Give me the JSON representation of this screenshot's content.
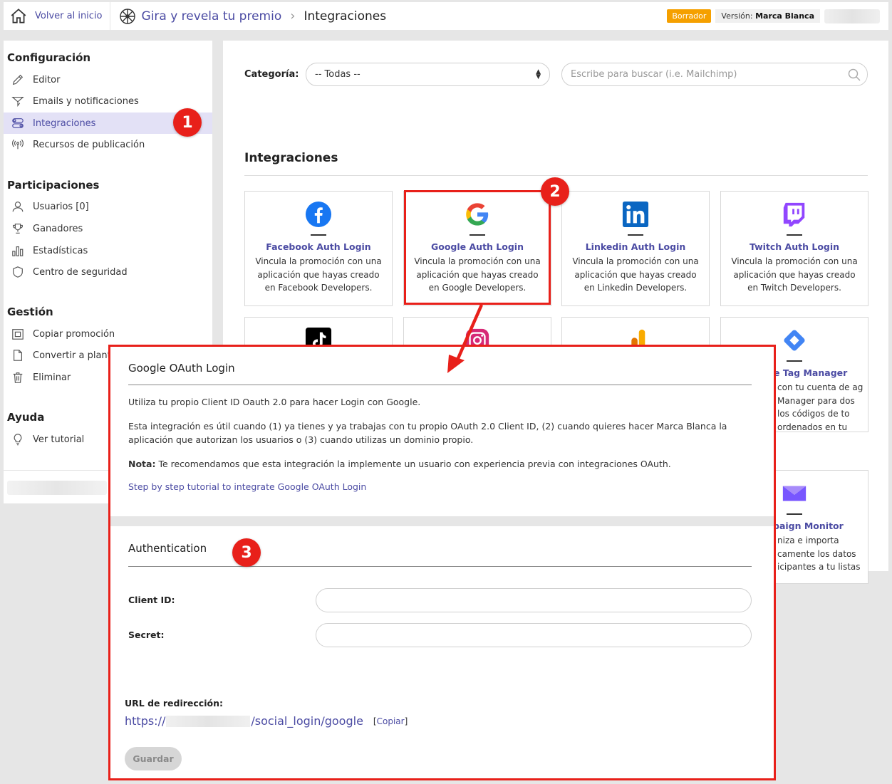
{
  "topbar": {
    "home_label": "Volver al inicio",
    "campaign_title": "Gira y revela tu premio",
    "current_page": "Integraciones",
    "status_badge": "Borrador",
    "version_prefix": "Versión:",
    "version_value": "Marca Blanca"
  },
  "sidebar": {
    "sections": [
      {
        "title": "Configuración",
        "items": [
          {
            "label": "Editor",
            "icon": "pencil-icon"
          },
          {
            "label": "Emails y notificaciones",
            "icon": "paper-plane-icon"
          },
          {
            "label": "Integraciones",
            "icon": "toggles-icon",
            "active": true
          },
          {
            "label": "Recursos de publicación",
            "icon": "broadcast-icon"
          }
        ]
      },
      {
        "title": "Participaciones",
        "items": [
          {
            "label": "Usuarios [0]",
            "icon": "user-icon"
          },
          {
            "label": "Ganadores",
            "icon": "trophy-icon"
          },
          {
            "label": "Estadísticas",
            "icon": "bar-chart-icon"
          },
          {
            "label": "Centro de seguridad",
            "icon": "shield-icon"
          }
        ]
      },
      {
        "title": "Gestión",
        "items": [
          {
            "label": "Copiar promoción",
            "icon": "copy-icon"
          },
          {
            "label": "Convertir a plantil",
            "icon": "document-icon"
          },
          {
            "label": "Eliminar",
            "icon": "trash-icon"
          }
        ]
      },
      {
        "title": "Ayuda",
        "items": [
          {
            "label": "Ver tutorial",
            "icon": "lightbulb-icon"
          }
        ]
      }
    ]
  },
  "filters": {
    "category_label": "Categoría:",
    "category_value": "-- Todas --",
    "search_placeholder": "Escribe para buscar (i.e. Mailchimp)"
  },
  "integrations": {
    "title": "Integraciones",
    "cards": [
      {
        "title": "Facebook Auth Login",
        "desc": "Vincula la promoción con una aplicación que hayas creado en Facebook Developers.",
        "icon": "facebook-icon",
        "color": "#1877f2"
      },
      {
        "title": "Google Auth Login",
        "desc": "Vincula la promoción con una aplicación que hayas creado en Google Developers.",
        "icon": "google-icon",
        "color": "#4285f4"
      },
      {
        "title": "Linkedin Auth Login",
        "desc": "Vincula la promoción con una aplicación que hayas creado en Linkedin Developers.",
        "icon": "linkedin-icon",
        "color": "#0a66c2"
      },
      {
        "title": "Twitch Auth Login",
        "desc": "Vincula la promoción con una aplicación que hayas creado en Twitch Developers.",
        "icon": "twitch-icon",
        "color": "#9146ff"
      },
      {
        "title": "e Tag Manager",
        "desc": "con tu cuenta de ag Manager para dos los códigos de to ordenados en tu romoción.",
        "icon": "tag-manager-icon"
      },
      {
        "title": "paign Monitor",
        "desc": "niza e importa camente los datos icipantes a tu listas",
        "icon": "campaign-monitor-icon"
      }
    ]
  },
  "modal": {
    "title": "Google OAuth Login",
    "p1": "Utiliza tu propio Client ID Oauth 2.0 para hacer Login con Google.",
    "p2": "Esta integración es útil cuando (1) ya tienes y ya trabajas con tu propio OAuth 2.0 Client ID, (2) cuando quieres hacer Marca Blanca la aplicación que autorizan los usuarios o (3) cuando utilizas un dominio propio.",
    "note_label": "Nota:",
    "note_text": "Te recomendamos que esta integración la implemente un usuario con experiencia previa con integraciones OAuth.",
    "tutorial_link": "Step by step tutorial to integrate Google OAuth Login",
    "auth_title": "Authentication",
    "client_id_label": "Client ID:",
    "secret_label": "Secret:",
    "redirect_label": "URL de redirección:",
    "redirect_prefix": "https://",
    "redirect_suffix": "/social_login/google",
    "copy_open": "[",
    "copy_label": "Copiar",
    "copy_close": "]",
    "save_label": "Guardar"
  },
  "annotations": {
    "marker_1": "1",
    "marker_2": "2",
    "marker_3": "3",
    "color": "#e8201a"
  }
}
